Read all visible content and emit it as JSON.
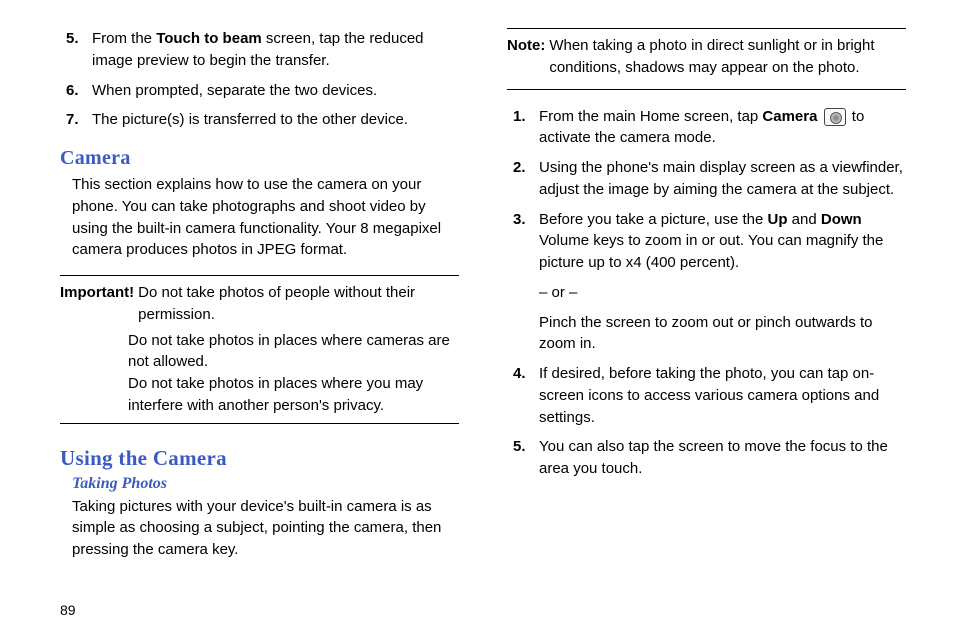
{
  "leftCol": {
    "listA": [
      {
        "num": "5.",
        "pre": "From the ",
        "bold": "Touch to beam",
        "post": " screen, tap the reduced image preview to begin the transfer."
      },
      {
        "num": "6.",
        "text": "When prompted, separate the two devices."
      },
      {
        "num": "7.",
        "text": "The picture(s) is transferred to the other device."
      }
    ],
    "cameraHeading": "Camera",
    "cameraIntro": "This section explains how to use the camera on your phone. You can take photographs and shoot video by using the built-in camera functionality. Your 8 megapixel camera produces photos in JPEG format.",
    "important": {
      "label": "Important!",
      "first": " Do not take photos of people without their permission.",
      "lines": [
        "Do not take photos in places where cameras are not allowed.",
        "Do not take photos in places where you may interfere with another person's privacy."
      ]
    },
    "usingHeading": "Using the Camera",
    "takingSub": "Taking Photos",
    "takingPara": "Taking pictures with your device's built-in camera is as simple as choosing a subject, pointing the camera, then pressing the camera key."
  },
  "rightCol": {
    "note": {
      "label": "Note:",
      "text": " When taking a photo in direct sunlight or in bright conditions, shadows may appear on the photo."
    },
    "list": [
      {
        "num": "1.",
        "pre": "From the main Home screen, tap ",
        "bold": "Camera",
        "icon": true,
        "post": " to activate the camera mode."
      },
      {
        "num": "2.",
        "text": "Using the phone's main display screen as a viewfinder, adjust the image by aiming the camera at the subject."
      },
      {
        "num": "3.",
        "pre": "Before you take a picture, use the ",
        "bold": "Up",
        "mid1": " and ",
        "bold2": "Down",
        "post": " Volume keys to zoom in or out. You can magnify the picture up to x4 (400 percent).",
        "orline": "– or –",
        "alt": "Pinch the screen to zoom out or pinch outwards to zoom in."
      },
      {
        "num": "4.",
        "text": "If desired, before taking the photo, you can tap on-screen icons to access various camera options and settings."
      },
      {
        "num": "5.",
        "text": "You can also tap the screen to move the focus to the area you touch."
      }
    ]
  },
  "pageNum": "89"
}
